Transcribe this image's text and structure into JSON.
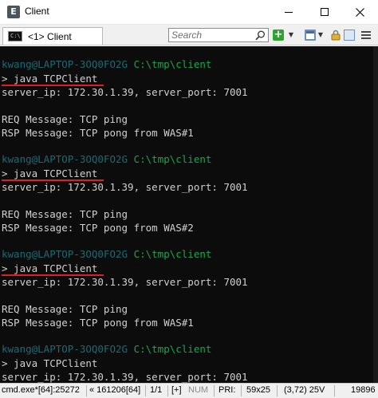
{
  "window": {
    "title": "Client",
    "app_icon_letter": "E"
  },
  "toolbar": {
    "tab_label": "<1> Client",
    "tab_icon_text": "C:\\",
    "search_placeholder": "Search"
  },
  "console": {
    "prompt_user": "kwang@LAPTOP-3OQ0FO2G",
    "prompt_path": "C:\\tmp\\client",
    "blocks": [
      {
        "command": "> java TCPClient",
        "server_info": "server_ip: 172.30.1.39, server_port: 7001",
        "req": "REQ Message: TCP ping",
        "rsp": "RSP Message: TCP pong from WAS#1"
      },
      {
        "command": "> java TCPClient",
        "server_info": "server_ip: 172.30.1.39, server_port: 7001",
        "req": "REQ Message: TCP ping",
        "rsp": "RSP Message: TCP pong from WAS#2"
      },
      {
        "command": "> java TCPClient",
        "server_info": "server_ip: 172.30.1.39, server_port: 7001",
        "req": "REQ Message: TCP ping",
        "rsp": "RSP Message: TCP pong from WAS#1"
      },
      {
        "command": "> java TCPClient",
        "server_info": "server_ip: 172.30.1.39, server_port: 7001"
      }
    ]
  },
  "statusbar": {
    "process": "cmd.exe*[64]:25272",
    "buffer": "« 161206[64]",
    "page": "1/1",
    "insert": "[+]",
    "num": "NUM",
    "priority": "PRI:",
    "size": "59x25",
    "cursor": "(3,72) 25V",
    "pid": "19896"
  },
  "colors": {
    "console_bg": "#0c0c0c",
    "console_text": "#d0d0d0",
    "prompt_user": "#1d6a72",
    "prompt_path": "#14a84a",
    "annotation_underline": "#e02020"
  }
}
